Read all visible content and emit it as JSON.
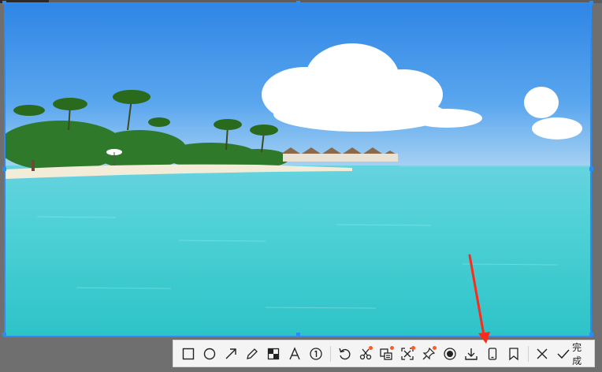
{
  "window": {
    "accent_color": "#2d8cf0",
    "annotation_color": "#ff2a1a"
  },
  "toolbar": {
    "tools": [
      {
        "name": "rectangle-tool",
        "icon": "rectangle-icon"
      },
      {
        "name": "ellipse-tool",
        "icon": "circle-icon"
      },
      {
        "name": "arrow-tool",
        "icon": "arrow-icon"
      },
      {
        "name": "pen-tool",
        "icon": "pencil-icon"
      },
      {
        "name": "mosaic-tool",
        "icon": "mosaic-icon"
      },
      {
        "name": "text-tool",
        "icon": "text-icon"
      },
      {
        "name": "number-tool",
        "icon": "number-circle-icon"
      },
      {
        "name": "undo-tool",
        "icon": "undo-icon"
      },
      {
        "name": "scissors-tool",
        "icon": "scissors-icon"
      },
      {
        "name": "ocr-tool",
        "icon": "ocr-icon"
      },
      {
        "name": "scan-tool",
        "icon": "scan-icon"
      },
      {
        "name": "pin-tool",
        "icon": "pin-icon"
      },
      {
        "name": "record-tool",
        "icon": "record-icon"
      },
      {
        "name": "download-tool",
        "icon": "download-icon"
      },
      {
        "name": "phone-tool",
        "icon": "phone-icon"
      },
      {
        "name": "bookmark-tool",
        "icon": "bookmark-icon"
      }
    ],
    "close_icon": "close-icon",
    "done_icon": "check-icon",
    "done_label": "完成"
  }
}
